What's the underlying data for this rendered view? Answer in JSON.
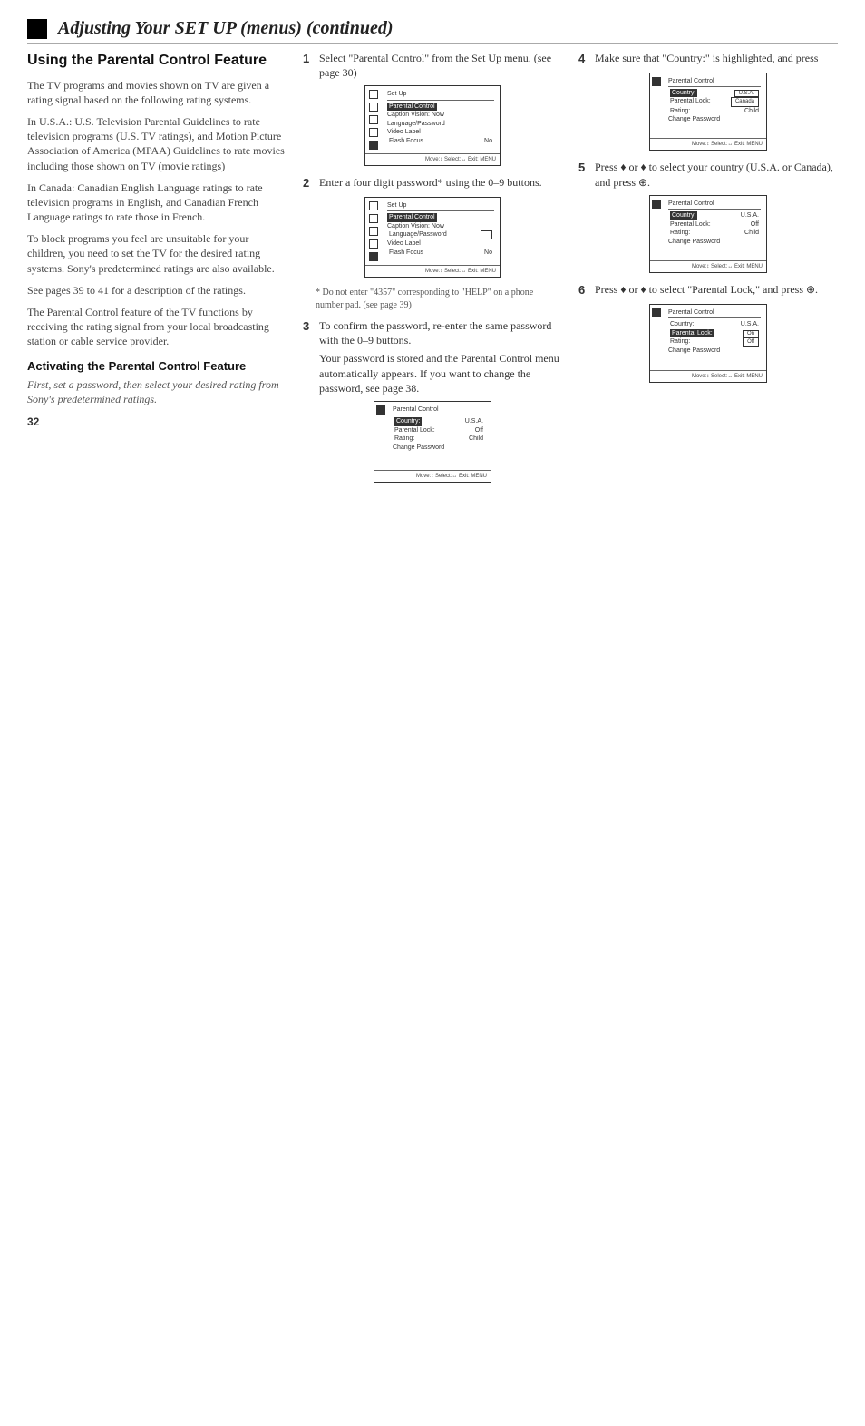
{
  "header": {
    "title": "Adjusting Your SET UP (menus) (continued)"
  },
  "col1": {
    "h2": "Using the Parental Control Feature",
    "p1": "The TV programs and movies shown on TV are given a rating signal based on the following rating systems.",
    "p2": "In U.S.A.: U.S. Television Parental Guidelines to rate television programs (U.S. TV ratings), and Motion Picture Association of America (MPAA) Guidelines to rate movies including those shown on TV (movie ratings)",
    "p3": "In Canada: Canadian English Language ratings to rate television programs in English, and Canadian French Language ratings to rate those in French.",
    "p4": "To block programs you feel are unsuitable for your children, you need to set the TV for the desired rating systems. Sony's predetermined ratings are also available.",
    "p5": "See pages 39 to 41 for a description of the ratings.",
    "p6": "The Parental Control feature of the TV functions by receiving the rating signal from your local broadcasting station or cable service provider.",
    "h3": "Activating the Parental Control Feature",
    "p7": "First, set a password, then select your desired rating from Sony's predetermined ratings.",
    "pgnum": "32"
  },
  "col2": {
    "step1": "Select \"Parental Control\" from the Set Up menu. (see page 30)",
    "step2": "Enter a four digit password* using the 0–9 buttons.",
    "note2": "* Do not enter \"4357\" corresponding to \"HELP\" on a phone number pad. (see page 39)",
    "step3a": "To confirm the password, re-enter the same password with the 0–9 buttons.",
    "step3b": "Your password is stored and the Parental Control menu automatically appears. If you want to change the password, see page 38."
  },
  "col3": {
    "step4": "Make sure that \"Country:\" is highlighted, and press",
    "step5": "Press ♦ or ♦ to select your country (U.S.A. or Canada), and press ⊕.",
    "step6": "Press ♦ or ♦ to select \"Parental Lock,\" and press ⊕."
  },
  "menu_setup": {
    "title": "Set Up",
    "hl": "Parental Control",
    "rows": [
      "Caption Vision: Now",
      "Language/Password",
      "Video Label"
    ],
    "flash": "Flash Focus",
    "flash_val": "No",
    "footer": "Move:↕  Select:↔  Exit: MENU"
  },
  "menu_parental": {
    "title": "Parental Control",
    "country_lbl": "Country:",
    "country_val": "U.S.A.",
    "lock_lbl": "Parental Lock:",
    "lock_val": "Off",
    "rating_lbl": "Rating:",
    "rating_val": "Child",
    "change": "Change Password",
    "footer": "Move:↕  Select:↔  Exit: MENU"
  },
  "menu_country_opts": {
    "opt1": "U.S.A.",
    "opt2": "Canada"
  },
  "menu_lock_opts": {
    "opt1": "On",
    "opt2": "Off"
  }
}
